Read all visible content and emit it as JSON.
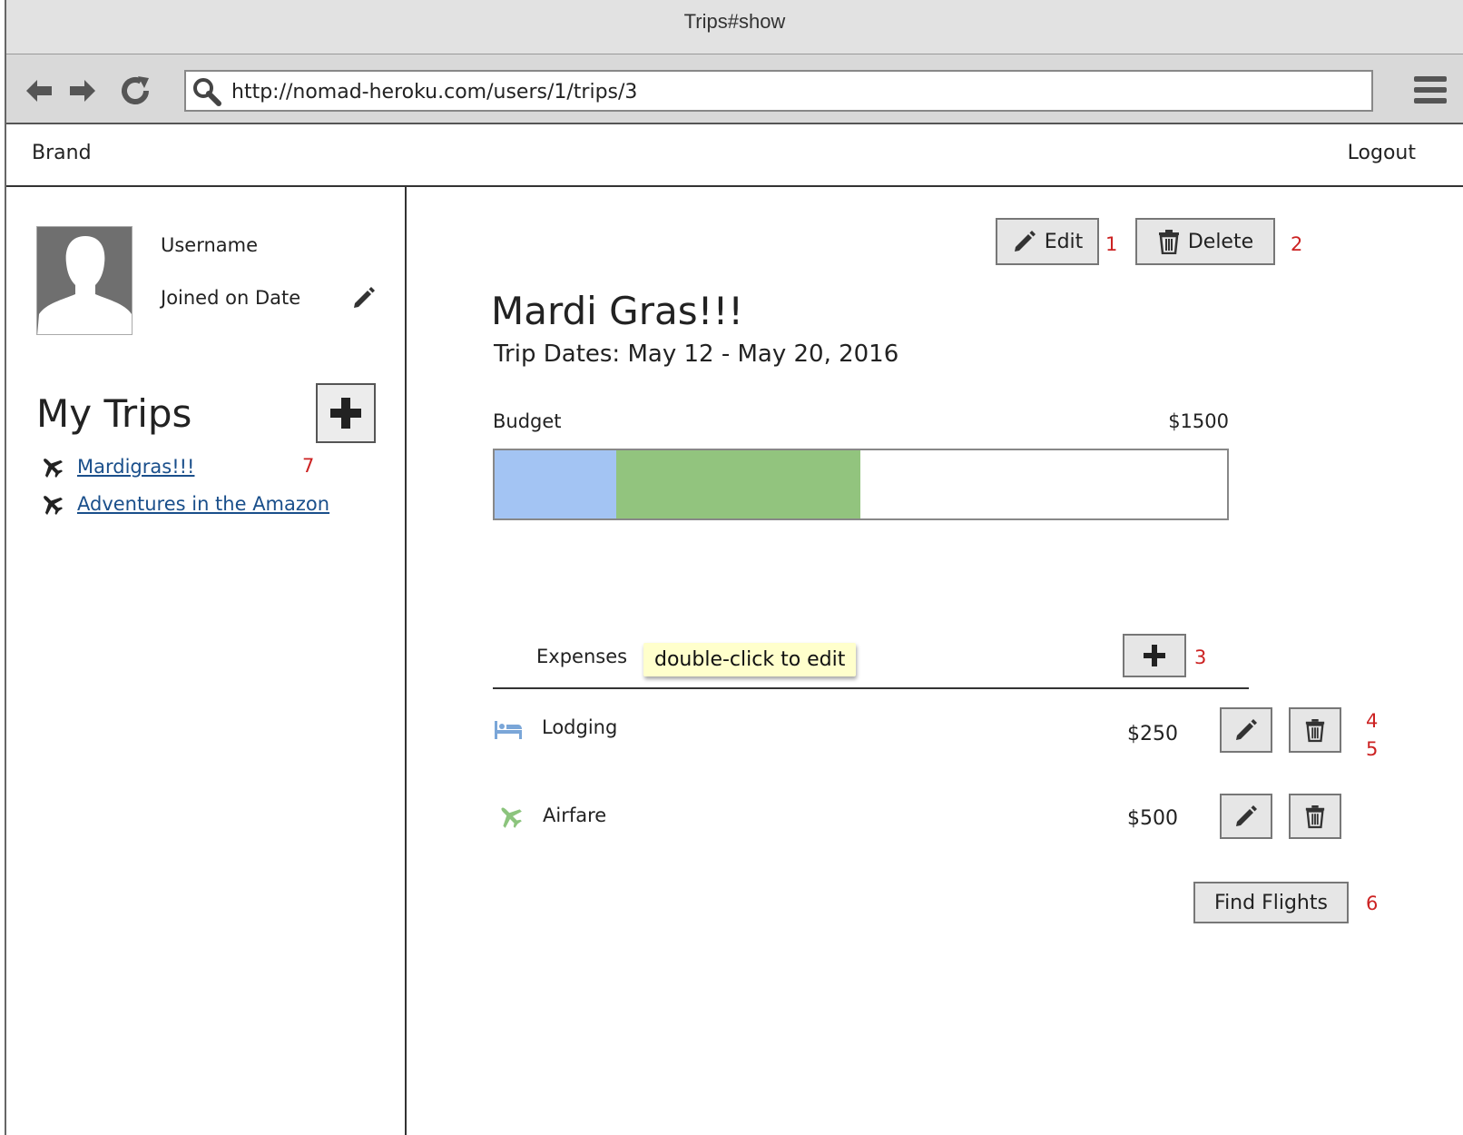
{
  "window": {
    "title": "Trips#show"
  },
  "browser": {
    "url": "http://nomad-heroku.com/users/1/trips/3"
  },
  "navbar": {
    "brand": "Brand",
    "logout": "Logout"
  },
  "profile": {
    "username": "Username",
    "joined": "Joined on Date"
  },
  "sidebar": {
    "heading": "My Trips",
    "trips": [
      {
        "label": "Mardigras!!!"
      },
      {
        "label": "Adventures in the Amazon"
      }
    ]
  },
  "trip": {
    "title": "Mardi Gras!!!",
    "dates": "Trip Dates: May 12 - May 20, 2016",
    "edit_label": "Edit",
    "delete_label": "Delete"
  },
  "budget": {
    "label": "Budget",
    "total_text": "$1500",
    "total": 1500,
    "segments": [
      {
        "category": "Lodging",
        "amount": 250,
        "color": "#a3c4f3"
      },
      {
        "category": "Airfare",
        "amount": 500,
        "color": "#92c47e"
      }
    ]
  },
  "expenses": {
    "label": "Expenses",
    "tooltip": "double-click to edit",
    "items": [
      {
        "name": "Lodging",
        "amount": "$250",
        "icon": "bed-icon",
        "color": "#7aa6d8"
      },
      {
        "name": "Airfare",
        "amount": "$500",
        "icon": "plane-icon",
        "color": "#8cc47d"
      }
    ],
    "find_flights_label": "Find Flights"
  },
  "annotations": {
    "n1": "1",
    "n2": "2",
    "n3": "3",
    "n4": "4",
    "n5": "5",
    "n6": "6",
    "n7": "7"
  },
  "colors": {
    "annotation": "#cc2222",
    "link": "#1a4f8b"
  }
}
